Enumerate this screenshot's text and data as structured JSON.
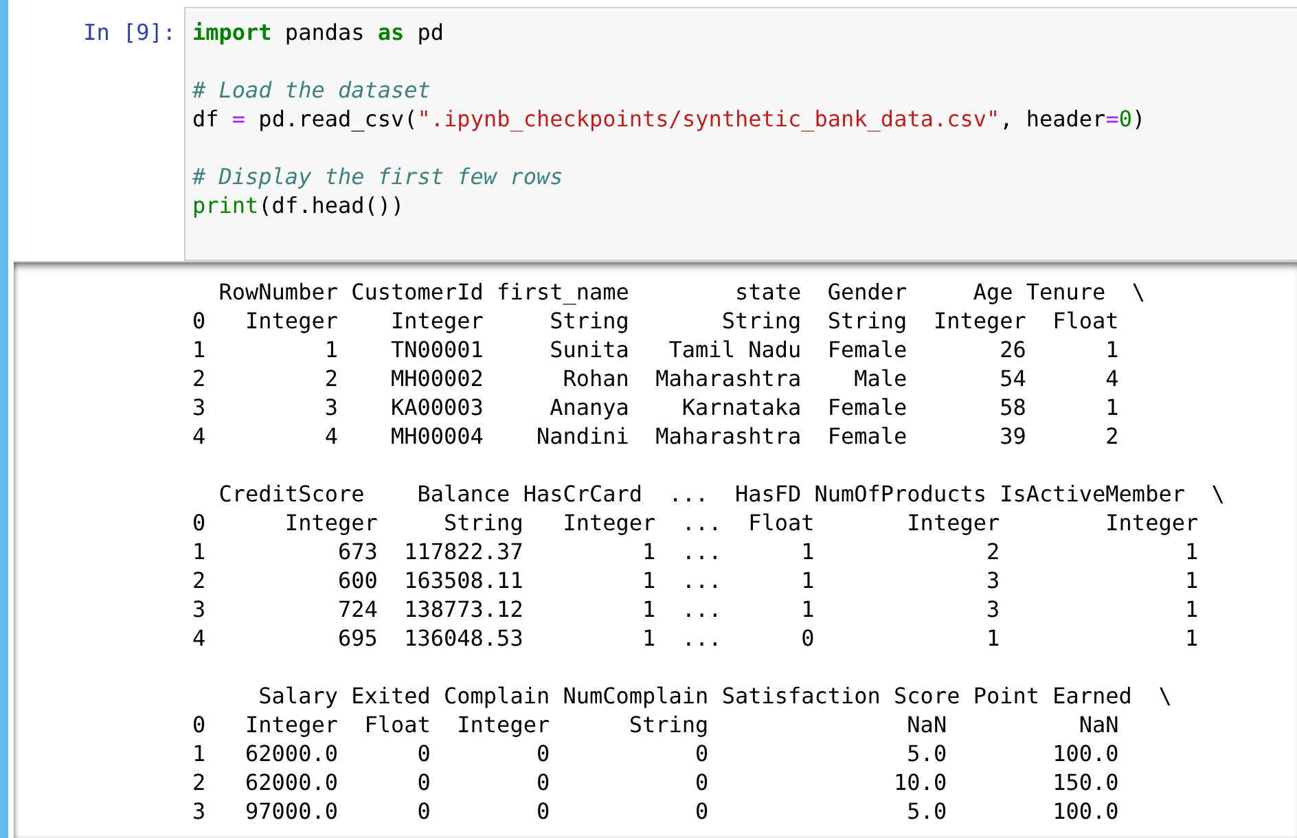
{
  "cell": {
    "prompt": "In [9]:",
    "code_lines": [
      {
        "tokens": [
          {
            "kind": "keyword",
            "text": "import"
          },
          {
            "kind": "name",
            "text": " pandas "
          },
          {
            "kind": "keyword",
            "text": "as"
          },
          {
            "kind": "name",
            "text": " pd"
          }
        ]
      },
      {
        "kind": "blank"
      },
      {
        "tokens": [
          {
            "kind": "comment",
            "text": "# Load the dataset"
          }
        ]
      },
      {
        "tokens": [
          {
            "kind": "name",
            "text": "df "
          },
          {
            "kind": "operator",
            "text": "="
          },
          {
            "kind": "name",
            "text": " pd.read_csv("
          },
          {
            "kind": "string",
            "text": "\".ipynb_checkpoints/synthetic_bank_data.csv\""
          },
          {
            "kind": "name",
            "text": ", header"
          },
          {
            "kind": "operator",
            "text": "="
          },
          {
            "kind": "number",
            "text": "0"
          },
          {
            "kind": "name",
            "text": ")"
          }
        ]
      },
      {
        "kind": "blank"
      },
      {
        "tokens": [
          {
            "kind": "comment",
            "text": "# Display the first few rows"
          }
        ]
      },
      {
        "tokens": [
          {
            "kind": "builtin",
            "text": "print"
          },
          {
            "kind": "name",
            "text": "(df.head())"
          }
        ]
      }
    ],
    "output_blocks": [
      [
        "  RowNumber CustomerId first_name        state  Gender     Age Tenure  \\",
        "0   Integer    Integer     String       String  String  Integer  Float",
        "1         1    TN00001     Sunita   Tamil Nadu  Female       26      1",
        "2         2    MH00002      Rohan  Maharashtra    Male       54      4",
        "3         3    KA00003     Ananya    Karnataka  Female       58      1",
        "4         4    MH00004    Nandini  Maharashtra  Female       39      2"
      ],
      [
        "  CreditScore    Balance HasCrCard  ...  HasFD NumOfProducts IsActiveMember  \\",
        "0      Integer     String   Integer  ...  Float       Integer        Integer",
        "1          673  117822.37         1  ...      1             2              1",
        "2          600  163508.11         1  ...      1             3              1",
        "3          724  138773.12         1  ...      1             3              1",
        "4          695  136048.53         1  ...      0             1              1"
      ],
      [
        "     Salary Exited Complain NumComplain Satisfaction Score Point Earned  \\",
        "0   Integer  Float  Integer      String               NaN          NaN",
        "1   62000.0      0        0           0               5.0        100.0",
        "2   62000.0      0        0           0              10.0        150.0",
        "3   97000.0      0        0           0               5.0        100.0"
      ]
    ]
  }
}
